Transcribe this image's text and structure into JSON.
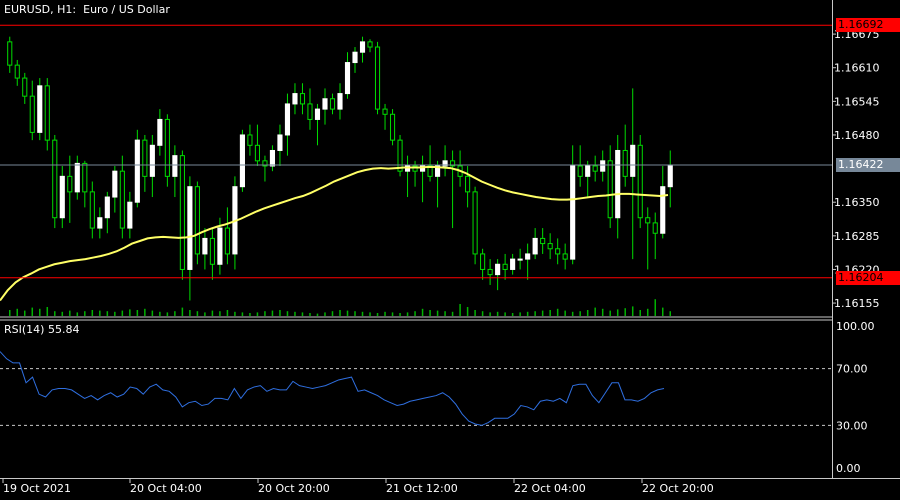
{
  "header": {
    "symbol": "EURUSD, H1:",
    "description": "Euro / US Dollar"
  },
  "indicator": {
    "label": "RSI(14) 55.84",
    "levels": [
      "100.00",
      "70.00",
      "30.00",
      "0.00"
    ],
    "color": "#2f6fe0"
  },
  "colors": {
    "background": "#000000",
    "bull_candle": "#ffffff",
    "wick": "#00dc00",
    "moving_average": "#ffff66",
    "hline": "#ff0000",
    "bid_line": "#778899"
  },
  "price_axis": {
    "labels": [
      "1.16675",
      "1.16610",
      "1.16545",
      "1.16480",
      "1.16350",
      "1.16285",
      "1.16220",
      "1.16155"
    ],
    "current_price": "1.16422",
    "hlines": [
      "1.16692",
      "1.16204"
    ]
  },
  "time_axis": {
    "labels": [
      "19 Oct 2021",
      "20 Oct 04:00",
      "20 Oct 20:00",
      "21 Oct 12:00",
      "22 Oct 04:00",
      "22 Oct 20:00"
    ]
  },
  "chart_data": {
    "type": "candlestick",
    "symbol": "EURUSD",
    "timeframe": "H1",
    "ylim": [
      1.1613,
      1.1671
    ],
    "hlines": [
      1.16692,
      1.16204
    ],
    "current_price": 1.16422,
    "candles": [
      [
        1.1666,
        1.1667,
        1.166,
        1.16615
      ],
      [
        1.16615,
        1.16625,
        1.16575,
        1.1659
      ],
      [
        1.1659,
        1.166,
        1.1654,
        1.16555
      ],
      [
        1.16555,
        1.16585,
        1.1647,
        1.16485
      ],
      [
        1.16485,
        1.1659,
        1.1647,
        1.16575
      ],
      [
        1.16575,
        1.1659,
        1.1645,
        1.1647
      ],
      [
        1.1647,
        1.1648,
        1.163,
        1.1632
      ],
      [
        1.1632,
        1.1642,
        1.163,
        1.164
      ],
      [
        1.164,
        1.1644,
        1.1631,
        1.1637
      ],
      [
        1.1637,
        1.1644,
        1.16355,
        1.16425
      ],
      [
        1.16425,
        1.1643,
        1.1634,
        1.1637
      ],
      [
        1.1637,
        1.1639,
        1.1628,
        1.163
      ],
      [
        1.163,
        1.1634,
        1.1628,
        1.1632
      ],
      [
        1.1632,
        1.1637,
        1.1629,
        1.1636
      ],
      [
        1.1636,
        1.1642,
        1.1633,
        1.1641
      ],
      [
        1.1641,
        1.1644,
        1.1628,
        1.163
      ],
      [
        1.163,
        1.1637,
        1.1628,
        1.1635
      ],
      [
        1.1635,
        1.1649,
        1.1634,
        1.1647
      ],
      [
        1.1647,
        1.1648,
        1.1637,
        1.164
      ],
      [
        1.164,
        1.1648,
        1.1636,
        1.1646
      ],
      [
        1.1646,
        1.1653,
        1.1644,
        1.1651
      ],
      [
        1.1651,
        1.1652,
        1.1638,
        1.164
      ],
      [
        1.164,
        1.1646,
        1.1636,
        1.1644
      ],
      [
        1.1644,
        1.1645,
        1.162,
        1.1622
      ],
      [
        1.1622,
        1.164,
        1.1616,
        1.1638
      ],
      [
        1.1638,
        1.1639,
        1.1623,
        1.1625
      ],
      [
        1.1625,
        1.163,
        1.1622,
        1.1628
      ],
      [
        1.1628,
        1.163,
        1.162,
        1.1623
      ],
      [
        1.1623,
        1.1632,
        1.1621,
        1.163
      ],
      [
        1.163,
        1.1634,
        1.1623,
        1.1625
      ],
      [
        1.1625,
        1.164,
        1.1622,
        1.1638
      ],
      [
        1.1638,
        1.1649,
        1.1637,
        1.1648
      ],
      [
        1.1648,
        1.165,
        1.1644,
        1.1646
      ],
      [
        1.1646,
        1.165,
        1.1642,
        1.1643
      ],
      [
        1.1643,
        1.1644,
        1.1639,
        1.1642
      ],
      [
        1.1642,
        1.1646,
        1.1641,
        1.1645
      ],
      [
        1.1645,
        1.165,
        1.1642,
        1.1648
      ],
      [
        1.1648,
        1.1656,
        1.1644,
        1.1654
      ],
      [
        1.1654,
        1.1658,
        1.1652,
        1.1656
      ],
      [
        1.1656,
        1.1658,
        1.1652,
        1.1654
      ],
      [
        1.1654,
        1.1657,
        1.1649,
        1.1651
      ],
      [
        1.1651,
        1.1654,
        1.1646,
        1.1653
      ],
      [
        1.1653,
        1.1657,
        1.165,
        1.1655
      ],
      [
        1.1655,
        1.1656,
        1.1652,
        1.1653
      ],
      [
        1.1653,
        1.1658,
        1.1651,
        1.1656
      ],
      [
        1.1656,
        1.1664,
        1.1655,
        1.1662
      ],
      [
        1.1662,
        1.1665,
        1.166,
        1.1664
      ],
      [
        1.1664,
        1.1667,
        1.1662,
        1.1666
      ],
      [
        1.1666,
        1.16665,
        1.1664,
        1.1665
      ],
      [
        1.1665,
        1.1666,
        1.1652,
        1.1653
      ],
      [
        1.1653,
        1.1654,
        1.1649,
        1.1652
      ],
      [
        1.1652,
        1.1653,
        1.1646,
        1.1647
      ],
      [
        1.1647,
        1.1648,
        1.164,
        1.1641
      ],
      [
        1.1641,
        1.1644,
        1.1636,
        1.1642
      ],
      [
        1.1642,
        1.1643,
        1.1638,
        1.1641
      ],
      [
        1.1641,
        1.1644,
        1.1635,
        1.1642
      ],
      [
        1.1642,
        1.1646,
        1.1639,
        1.164
      ],
      [
        1.164,
        1.1643,
        1.1634,
        1.1642
      ],
      [
        1.1642,
        1.1646,
        1.164,
        1.1643
      ],
      [
        1.1643,
        1.1645,
        1.163,
        1.1642
      ],
      [
        1.1642,
        1.1645,
        1.1638,
        1.164
      ],
      [
        1.164,
        1.1642,
        1.1634,
        1.1637
      ],
      [
        1.1637,
        1.1638,
        1.1623,
        1.1625
      ],
      [
        1.1625,
        1.1626,
        1.162,
        1.1622
      ],
      [
        1.1622,
        1.1624,
        1.1619,
        1.1621
      ],
      [
        1.1621,
        1.1624,
        1.1618,
        1.1623
      ],
      [
        1.1623,
        1.1625,
        1.162,
        1.1622
      ],
      [
        1.1622,
        1.1625,
        1.1621,
        1.1624
      ],
      [
        1.1624,
        1.1626,
        1.1622,
        1.1624
      ],
      [
        1.1624,
        1.1627,
        1.162,
        1.1625
      ],
      [
        1.1625,
        1.163,
        1.1624,
        1.1628
      ],
      [
        1.1628,
        1.163,
        1.1625,
        1.1627
      ],
      [
        1.1627,
        1.1629,
        1.1624,
        1.1626
      ],
      [
        1.1626,
        1.1628,
        1.1623,
        1.1625
      ],
      [
        1.1625,
        1.1627,
        1.1622,
        1.1624
      ],
      [
        1.1624,
        1.1646,
        1.1623,
        1.1642
      ],
      [
        1.1642,
        1.1646,
        1.1638,
        1.164
      ],
      [
        1.164,
        1.1643,
        1.1636,
        1.1642
      ],
      [
        1.1642,
        1.1644,
        1.1639,
        1.1641
      ],
      [
        1.1641,
        1.1645,
        1.1639,
        1.1643
      ],
      [
        1.1643,
        1.1646,
        1.163,
        1.1632
      ],
      [
        1.1632,
        1.1648,
        1.1628,
        1.1645
      ],
      [
        1.1645,
        1.165,
        1.1638,
        1.164
      ],
      [
        1.164,
        1.1657,
        1.1624,
        1.1646
      ],
      [
        1.1646,
        1.1648,
        1.163,
        1.1632
      ],
      [
        1.1632,
        1.1634,
        1.1622,
        1.1631
      ],
      [
        1.1631,
        1.1633,
        1.1624,
        1.1629
      ],
      [
        1.1629,
        1.1642,
        1.1628,
        1.1638
      ],
      [
        1.1638,
        1.1645,
        1.1634,
        1.16422
      ]
    ],
    "moving_average": [
      1.1616,
      1.1618,
      1.16195,
      1.16205,
      1.16212,
      1.1622,
      1.16225,
      1.1623,
      1.16233,
      1.16236,
      1.16238,
      1.1624,
      1.16243,
      1.16246,
      1.1625,
      1.16255,
      1.16262,
      1.1627,
      1.16275,
      1.1628,
      1.16282,
      1.16283,
      1.16282,
      1.16281,
      1.16282,
      1.16285,
      1.16292,
      1.16298,
      1.16303,
      1.16307,
      1.16312,
      1.16318,
      1.16325,
      1.16332,
      1.16338,
      1.16343,
      1.16348,
      1.16353,
      1.16358,
      1.16362,
      1.16368,
      1.16375,
      1.16382,
      1.1639,
      1.16396,
      1.16402,
      1.16408,
      1.16412,
      1.16415,
      1.16416,
      1.16415,
      1.16416,
      1.16417,
      1.16417,
      1.16417,
      1.16418,
      1.16418,
      1.16417,
      1.16416,
      1.16412,
      1.16406,
      1.16398,
      1.1639,
      1.16384,
      1.16378,
      1.16373,
      1.16369,
      1.16366,
      1.16363,
      1.1636,
      1.16358,
      1.16356,
      1.16355,
      1.16355,
      1.16356,
      1.16358,
      1.1636,
      1.16362,
      1.16363,
      1.16365,
      1.16366,
      1.16366,
      1.16365,
      1.16364,
      1.16363,
      1.16362,
      1.16364
    ],
    "volumes": [
      10,
      12,
      9,
      14,
      12,
      15,
      8,
      7,
      9,
      6,
      8,
      10,
      9,
      8,
      7,
      9,
      11,
      10,
      12,
      9,
      7,
      6,
      8,
      14,
      10,
      8,
      6,
      9,
      8,
      10,
      7,
      6,
      5,
      6,
      8,
      9,
      10,
      8,
      7,
      6,
      5,
      4,
      6,
      8,
      10,
      9,
      8,
      7,
      6,
      5,
      7,
      6,
      5,
      6,
      8,
      12,
      10,
      9,
      8,
      7,
      20,
      15,
      10,
      8,
      6,
      7,
      6,
      5,
      6,
      7,
      8,
      9,
      10,
      12,
      9,
      7,
      8,
      10,
      14,
      12,
      9,
      11,
      13,
      16,
      10,
      12,
      28,
      14,
      8
    ],
    "rsi": {
      "period": 14,
      "levels": [
        30,
        70
      ],
      "ylim": [
        0,
        100
      ],
      "values": [
        82,
        77,
        74,
        74,
        60,
        64,
        52,
        50,
        55,
        56,
        56,
        55,
        52,
        49,
        51,
        48,
        51,
        53,
        50,
        52,
        57,
        56,
        52,
        57,
        59,
        55,
        54,
        50,
        43,
        46,
        47,
        44,
        45,
        49,
        49,
        48,
        56,
        49,
        55,
        57,
        58,
        54,
        56,
        55,
        55,
        61,
        58,
        57,
        56,
        57,
        58,
        60,
        62,
        63,
        64,
        54,
        55,
        53,
        51,
        48,
        46,
        44,
        45,
        47,
        48,
        49,
        50,
        51,
        53,
        50,
        45,
        38,
        33,
        31,
        30,
        32,
        35,
        35,
        35,
        38,
        44,
        43,
        41,
        47,
        48,
        47,
        49,
        46,
        58,
        59,
        59,
        51,
        46,
        53,
        60,
        60,
        48,
        48,
        47,
        49,
        53,
        55,
        56
      ]
    },
    "time_labels": [
      "19 Oct 2021",
      "20 Oct 04:00",
      "20 Oct 20:00",
      "21 Oct 12:00",
      "22 Oct 04:00",
      "22 Oct 20:00"
    ]
  }
}
